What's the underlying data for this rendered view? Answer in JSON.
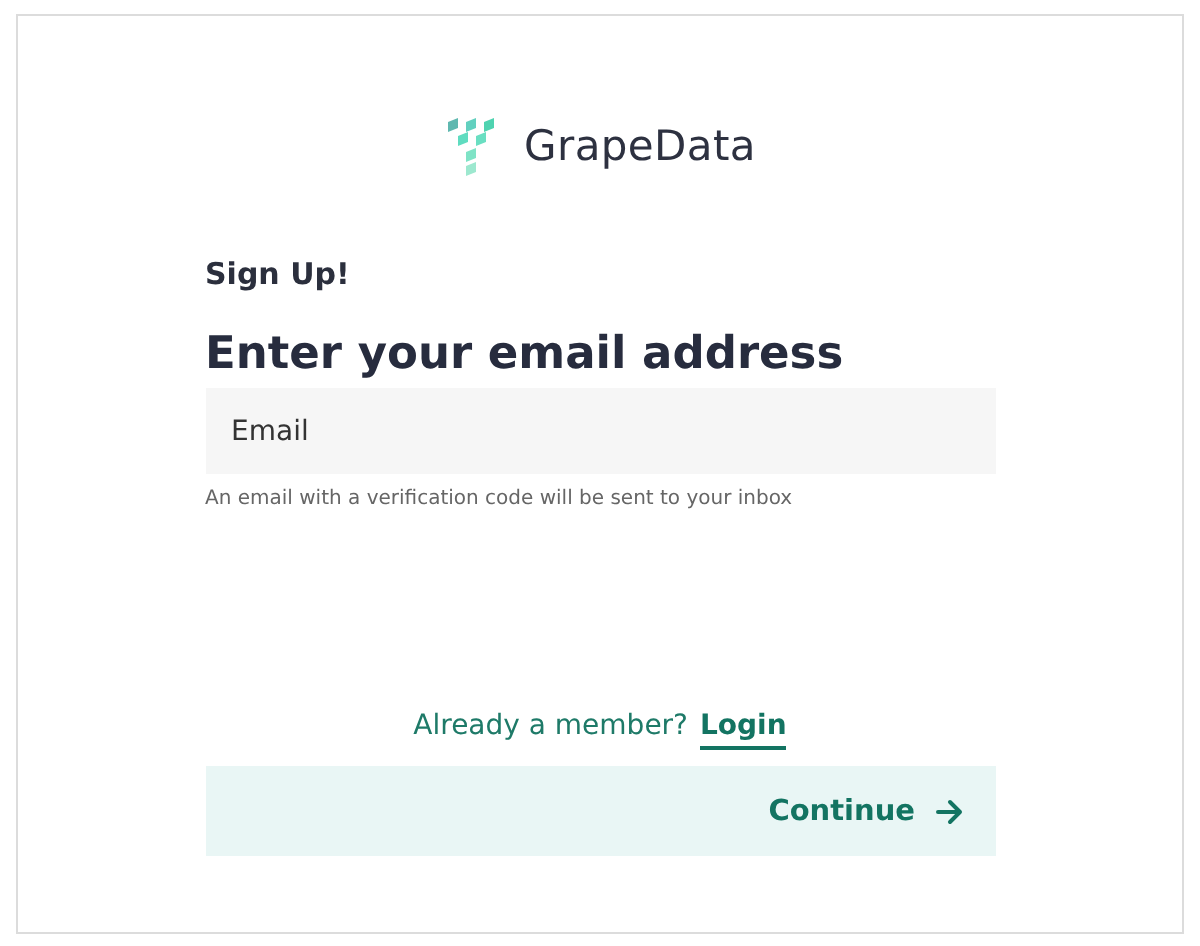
{
  "logo": {
    "name": "GrapeData"
  },
  "form": {
    "eyebrow": "Sign Up!",
    "heading": "Enter your email address",
    "email_field": {
      "placeholder": "Email"
    },
    "helper": "An email with a verification code will be sent to your inbox"
  },
  "login_prompt": {
    "text": "Already a member?",
    "link": "Login"
  },
  "continue_button": {
    "label": "Continue"
  }
}
